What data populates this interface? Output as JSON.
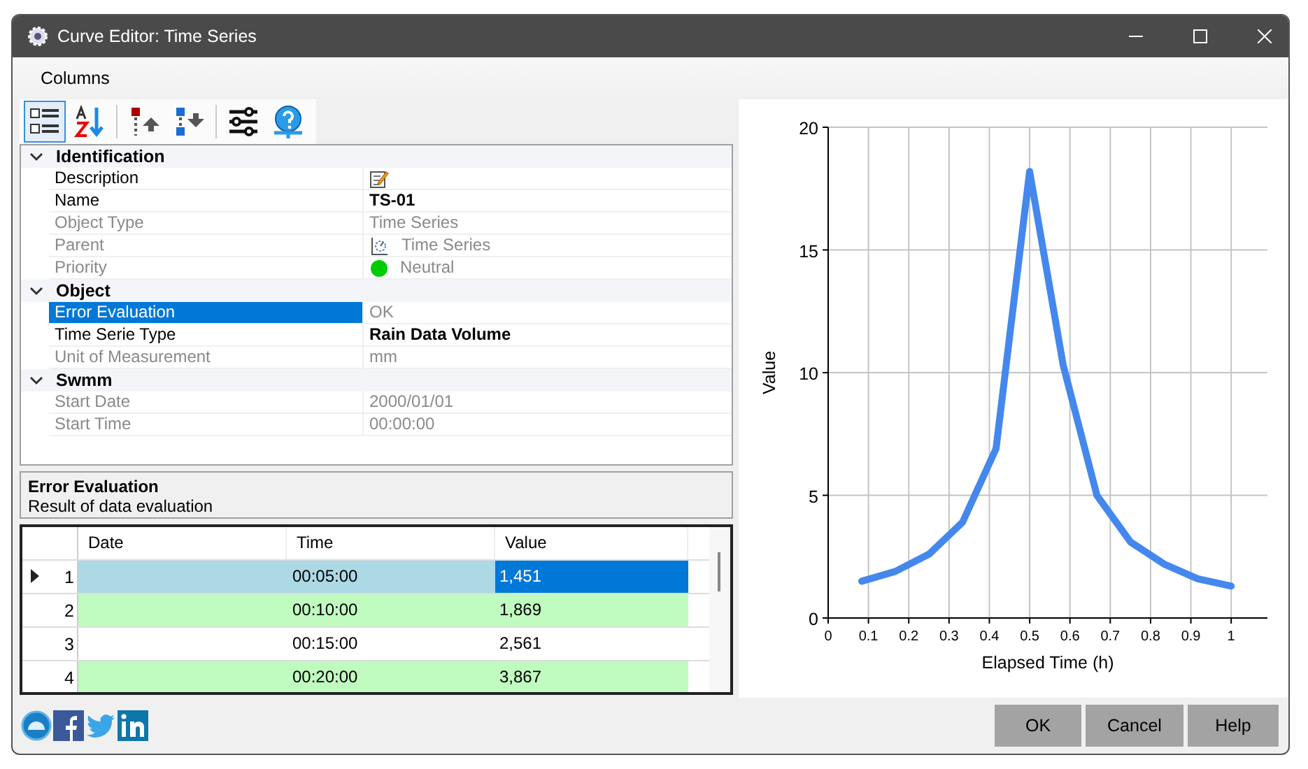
{
  "window": {
    "title": "Curve Editor: Time Series"
  },
  "menu": [
    "Columns"
  ],
  "toolbar": [
    {
      "kind": "categorized",
      "selected": true
    },
    {
      "kind": "alphabetical",
      "selected": false
    },
    {
      "kind": "sep"
    },
    {
      "kind": "up",
      "selected": false
    },
    {
      "kind": "down",
      "selected": false
    },
    {
      "kind": "sep"
    },
    {
      "kind": "settings",
      "selected": false
    },
    {
      "kind": "help",
      "selected": false
    }
  ],
  "properties": [
    {
      "category": "Identification",
      "expanded": true,
      "items": [
        {
          "label": "Description",
          "kind": "edit",
          "readonly": false,
          "selected": false
        },
        {
          "label": "Name",
          "value": "TS-01",
          "kind": "text",
          "readonly": false,
          "bold": true,
          "selected": false
        },
        {
          "label": "Object Type",
          "value": "Time Series",
          "kind": "text",
          "readonly": true,
          "bold": false,
          "selected": false
        },
        {
          "label": "Parent",
          "value": "Time Series",
          "kind": "parent",
          "readonly": true,
          "bold": false,
          "selected": false
        },
        {
          "label": "Priority",
          "value": "Neutral",
          "kind": "dot",
          "color": "#00cc00",
          "readonly": true,
          "bold": false,
          "selected": false
        }
      ]
    },
    {
      "category": "Object",
      "expanded": true,
      "items": [
        {
          "label": "Error Evaluation",
          "value": "OK",
          "kind": "text",
          "readonly": true,
          "bold": false,
          "selected": true
        },
        {
          "label": "Time Serie Type",
          "value": "Rain Data Volume",
          "kind": "text",
          "readonly": false,
          "bold": true,
          "selected": false
        },
        {
          "label": "Unit of Measurement",
          "value": "mm",
          "kind": "text",
          "readonly": true,
          "bold": false,
          "selected": false
        }
      ]
    },
    {
      "category": "Swmm",
      "expanded": true,
      "items": [
        {
          "label": "Start Date",
          "value": "2000/01/01",
          "kind": "text",
          "readonly": true,
          "bold": false,
          "selected": false
        },
        {
          "label": "Start Time",
          "value": "00:00:00",
          "kind": "text",
          "readonly": true,
          "bold": false,
          "selected": false
        }
      ]
    }
  ],
  "help": {
    "title": "Error Evaluation",
    "text": "Result of data evaluation"
  },
  "table": {
    "columns": [
      "Date",
      "Time",
      "Value"
    ],
    "rows": [
      {
        "number": "1",
        "time": "00:05:00",
        "value": "1,451",
        "selected": true,
        "highlighted": false
      },
      {
        "number": "2",
        "time": "00:10:00",
        "value": "1,869",
        "selected": false,
        "highlighted": true
      },
      {
        "number": "3",
        "time": "00:15:00",
        "value": "2,561",
        "selected": false,
        "highlighted": false
      },
      {
        "number": "4",
        "time": "00:20:00",
        "value": "3,867",
        "selected": false,
        "highlighted": true
      }
    ]
  },
  "chart_data": {
    "type": "line",
    "xlabel": "Elapsed Time (h)",
    "ylabel": "Value",
    "x": [
      0.0833,
      0.1667,
      0.25,
      0.3333,
      0.4167,
      0.5,
      0.5833,
      0.6667,
      0.75,
      0.8333,
      0.9167,
      1
    ],
    "series": [
      {
        "color": "#4488ee",
        "values": [
          1.5,
          1.9,
          2.6,
          3.9,
          6.9,
          18.2,
          10.3,
          5.0,
          3.1,
          2.2,
          1.6,
          1.3
        ]
      }
    ],
    "grid": true,
    "xlim": [
      0,
      1.09
    ],
    "ylim": [
      0,
      20
    ],
    "xticks": [
      0,
      0.1,
      0.2,
      0.3,
      0.4,
      0.5,
      0.6,
      0.7,
      0.8,
      0.9,
      1
    ],
    "yticks": [
      0,
      5,
      10,
      15,
      20
    ]
  },
  "social": [
    {
      "kind": "site"
    },
    {
      "kind": "facebook"
    },
    {
      "kind": "twitter"
    },
    {
      "kind": "linkedin"
    }
  ],
  "buttons": [
    "OK",
    "Cancel",
    "Help"
  ]
}
